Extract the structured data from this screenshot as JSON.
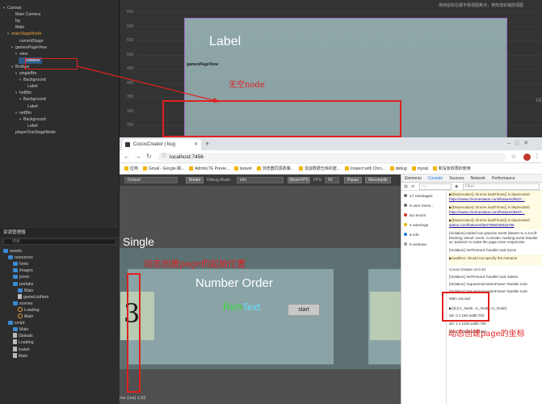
{
  "hierarchy": {
    "items": [
      {
        "label": "Canvas",
        "indent": 0,
        "tri": true,
        "state": ""
      },
      {
        "label": "Main Camera",
        "indent": 2,
        "tri": false,
        "state": ""
      },
      {
        "label": "bg",
        "indent": 2,
        "tri": false,
        "state": ""
      },
      {
        "label": "Main",
        "indent": 2,
        "tri": false,
        "state": ""
      },
      {
        "label": "mainStageNode",
        "indent": 1,
        "tri": true,
        "state": "hl"
      },
      {
        "label": "currentStage",
        "indent": 3,
        "tri": false,
        "state": ""
      },
      {
        "label": "gamesPageView",
        "indent": 2,
        "tri": true,
        "state": ""
      },
      {
        "label": "view",
        "indent": 3,
        "tri": true,
        "state": ""
      },
      {
        "label": "content",
        "indent": 4,
        "tri": false,
        "state": "sel"
      },
      {
        "label": "Brollyer",
        "indent": 2,
        "tri": true,
        "state": ""
      },
      {
        "label": "singleBtn",
        "indent": 3,
        "tri": true,
        "state": ""
      },
      {
        "label": "Background",
        "indent": 4,
        "tri": true,
        "state": ""
      },
      {
        "label": "Label",
        "indent": 5,
        "tri": false,
        "state": ""
      },
      {
        "label": "hotBtn",
        "indent": 3,
        "tri": true,
        "state": ""
      },
      {
        "label": "Background",
        "indent": 4,
        "tri": true,
        "state": ""
      },
      {
        "label": "Label",
        "indent": 5,
        "tri": false,
        "state": ""
      },
      {
        "label": "netBtn",
        "indent": 3,
        "tri": true,
        "state": ""
      },
      {
        "label": "Background",
        "indent": 4,
        "tri": true,
        "state": ""
      },
      {
        "label": "Label",
        "indent": 5,
        "tri": false,
        "state": ""
      },
      {
        "label": "playerOneStageNode",
        "indent": 2,
        "tri": false,
        "state": ""
      }
    ]
  },
  "scene": {
    "hint": "使用鼠标右键平移视图焦点，使用滚轮缩放视图",
    "ruler": [
      "650",
      "600",
      "550",
      "500",
      "450",
      "400",
      "350",
      "300",
      "250"
    ],
    "canvas_label": "Label",
    "node_tag": "gamesPageView",
    "right_edge": "UI"
  },
  "assets": {
    "title": "资源管理器",
    "search_placeholder": "搜索",
    "items": [
      {
        "label": "assets",
        "indent": 0,
        "kind": "folder"
      },
      {
        "label": "resources",
        "indent": 1,
        "kind": "folder"
      },
      {
        "label": "fonts",
        "indent": 2,
        "kind": "folder"
      },
      {
        "label": "images",
        "indent": 2,
        "kind": "folder"
      },
      {
        "label": "jsons",
        "indent": 2,
        "kind": "folder"
      },
      {
        "label": "prefabs",
        "indent": 2,
        "kind": "folder"
      },
      {
        "label": "Main",
        "indent": 3,
        "kind": "folder"
      },
      {
        "label": "gameListItem",
        "indent": 3,
        "kind": "file"
      },
      {
        "label": "scenes",
        "indent": 2,
        "kind": "folder"
      },
      {
        "label": "Loading",
        "indent": 3,
        "kind": "scene"
      },
      {
        "label": "Main",
        "indent": 3,
        "kind": "scene"
      },
      {
        "label": "script",
        "indent": 1,
        "kind": "folder"
      },
      {
        "label": "Main",
        "indent": 2,
        "kind": "folder"
      },
      {
        "label": "Globals",
        "indent": 2,
        "kind": "file"
      },
      {
        "label": "Loading",
        "indent": 2,
        "kind": "file"
      },
      {
        "label": "tostsh",
        "indent": 2,
        "kind": "file"
      },
      {
        "label": "Main",
        "indent": 2,
        "kind": "file"
      }
    ]
  },
  "browser": {
    "tab_title": "CocosCreator | bug",
    "url": "localhost:7456",
    "bookmarks": [
      "应用",
      "Gmail - Google 邮...",
      "AdminLTE Previe...",
      "laravel",
      "浏览器同源政策...",
      "浅谈数据仓库的建...",
      "Inspect with Chro...",
      "debug",
      "mysql",
      "和没有权限的使用"
    ]
  },
  "game": {
    "toolbar": {
      "device": "Default",
      "rotate": "Rotate",
      "debug_mode_label": "Debug Mode:",
      "debug_mode": "Info",
      "show_fps": "Show FPS",
      "fps_label": "FPS:",
      "fps": "60",
      "pause": "Pause",
      "recompile": "Recompile"
    },
    "single": "Single",
    "number_order": "Number Order",
    "rich": "Rich",
    "text": "Text",
    "start": "start",
    "digit": "3",
    "bottom": "me (ms)       1.65"
  },
  "devtools": {
    "tabs": [
      "Elements",
      "Console",
      "Sources",
      "Network",
      "Performance"
    ],
    "active_tab": "Console",
    "context": "top",
    "filter_placeholder": "Filter",
    "sidebar": [
      {
        "label": "17 messages",
        "color": "#6d6d6d"
      },
      {
        "label": "9 user mess...",
        "color": "#6d6d6d"
      },
      {
        "label": "No errors",
        "color": "#d93025"
      },
      {
        "label": "4 warnings",
        "color": "#f2b400"
      },
      {
        "label": "8 info",
        "color": "#1a73e8"
      },
      {
        "label": "5 verbose",
        "color": "#999999"
      }
    ],
    "logs": [
      {
        "text": "▶[Deprecation] chrome.loadTimes() is deprecated",
        "link": "https://www.chromestatus.com/features/5637...",
        "warn": true
      },
      {
        "text": "▶[Deprecation] chrome.loadTimes() is deprecated",
        "link": "https://www.chromestatus.com/features/5637...",
        "warn": true
      },
      {
        "text": "▶[Deprecation] chrome.loadTimes() is deprecated",
        "link": "status.com/features/5637885046816768",
        "warn": true
      },
      {
        "text": "[Violation] Added non-passive event listener to a scroll-blocking 'wheel' event. Consider marking event handler as 'passive' to make the page more responsive.",
        "link": "",
        "warn": false
      },
      {
        "text": "[Violation] 'setTimeout' handler took 51ms",
        "link": "",
        "warn": false
      },
      {
        "text": "▶loadRes: should not specify the extname",
        "link": "",
        "warn": true
      },
      {
        "text": "Cocos Creator v2.0.10",
        "link": "",
        "warn": false
      },
      {
        "text": "[Violation] 'setTimeout' handler took 336ms",
        "link": "",
        "warn": false
      },
      {
        "text": "[Violation] 'requestAnimationFrame' handler took",
        "link": "",
        "warn": false
      },
      {
        "text": "[Violation] 'requestAnimationFrame' handler took",
        "link": "",
        "warn": false
      },
      {
        "text": "Main onLoad",
        "link": "",
        "warn": false
      },
      {
        "text": "▶(3) [cc_Node, cc_Node, cc_Node]",
        "link": "",
        "warn": false
      },
      {
        "text": "ids: 0 x:150 width:700",
        "link": "",
        "warn": false
      },
      {
        "text": "ids: 1 x:1150 width:700",
        "link": "",
        "warn": false
      },
      {
        "text": "ids: 2 x:1950 width:700",
        "link": "",
        "warn": false
      }
    ]
  },
  "annotations": {
    "empty_node": "无空node",
    "start_position": "动态创建page的起始位置",
    "page_coords": "动态创建page的坐标"
  },
  "colors": {
    "annotation_red": "#e02020",
    "selection_blue": "#2e5a86",
    "highlight_orange": "#e8a13d",
    "richtext_green": "#33dd33",
    "richtext_cyan": "#66e0ff"
  }
}
